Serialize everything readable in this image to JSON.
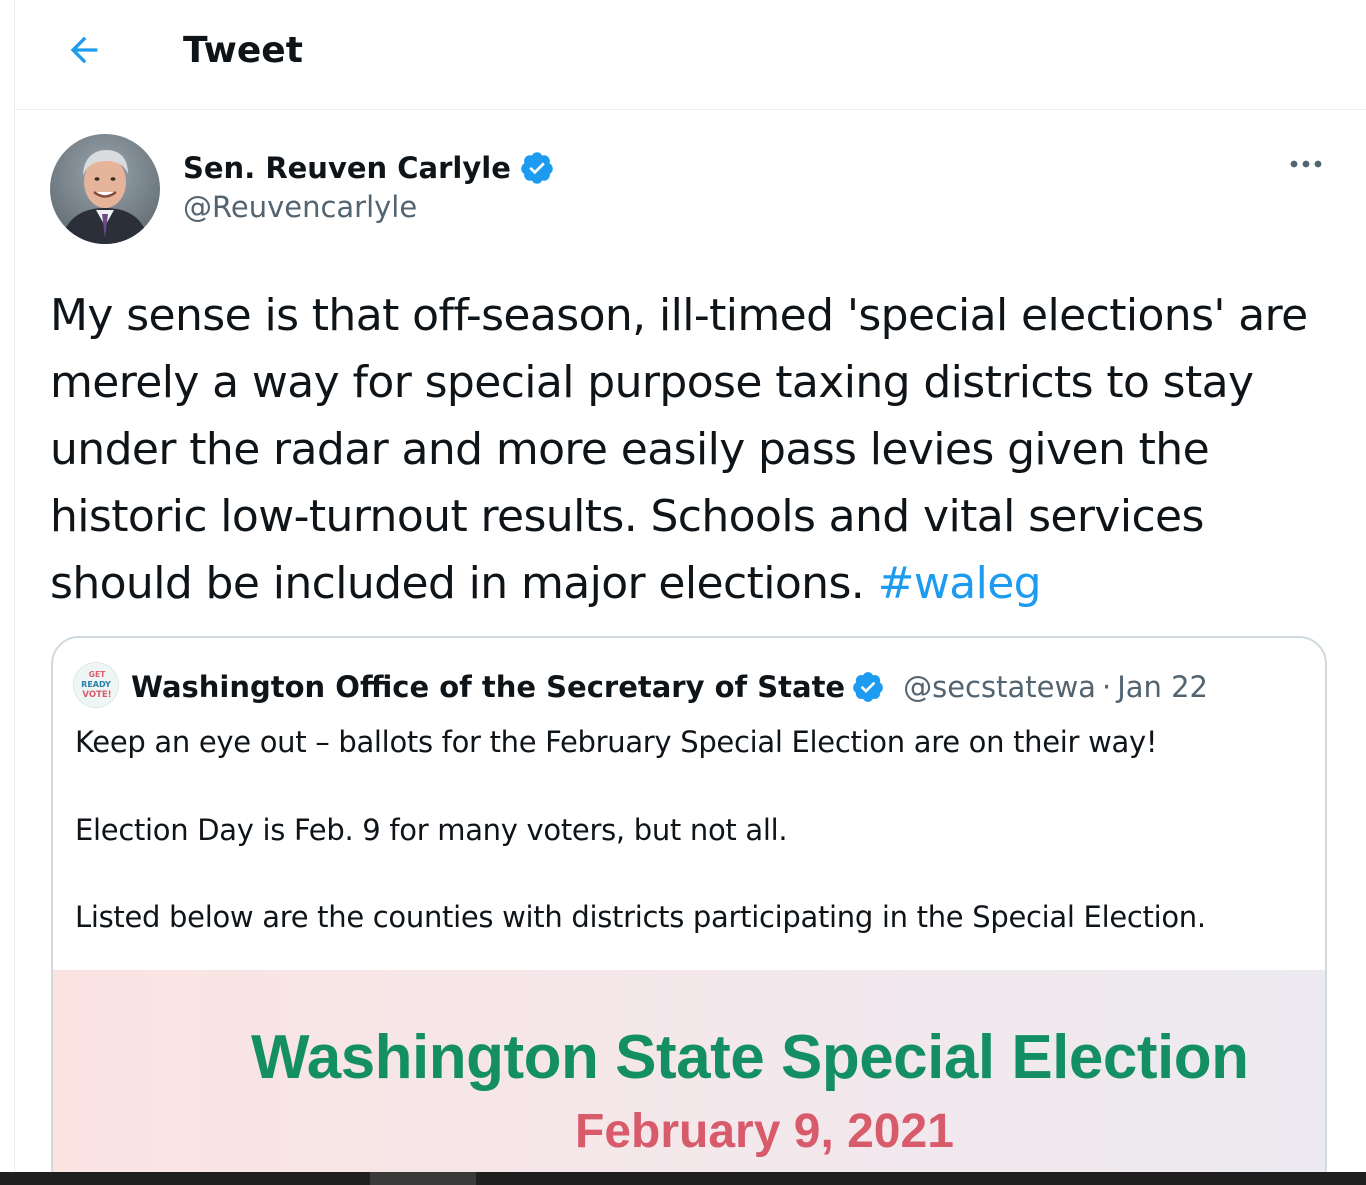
{
  "header": {
    "title": "Tweet",
    "back_icon": "arrow-left-icon"
  },
  "tweet": {
    "author": {
      "name": "Sen. Reuven Carlyle",
      "handle": "@Reuvencarlyle",
      "verified": true,
      "verified_color": "#1d9bf0"
    },
    "more_icon": "ellipsis-icon",
    "text": "My sense is that off-season, ill-timed 'special elections' are merely a way for special purpose taxing districts to stay under the radar and more easily pass levies given the historic low-turnout results. Schools and vital services should be included in major elections. ",
    "hashtag": "#waleg",
    "hashtag_color": "#1d9bf0"
  },
  "quote": {
    "avatar_text": {
      "line1": "GET",
      "line2": "READY",
      "line3": "VOTE!"
    },
    "name": "Washington Office of the Secretary of State",
    "verified": true,
    "handle": "@secstatewa",
    "separator": "·",
    "date": "Jan 22",
    "lines": [
      "Keep an eye out – ballots for the February Special Election are on their way!",
      "Election Day is Feb. 9 for many voters, but not all.",
      "Listed below are the counties with districts participating in the Special Election."
    ],
    "media": {
      "title": "Washington State Special Election",
      "date": "February 9, 2021",
      "title_color": "#138f63",
      "date_color": "#d85b6b"
    }
  }
}
